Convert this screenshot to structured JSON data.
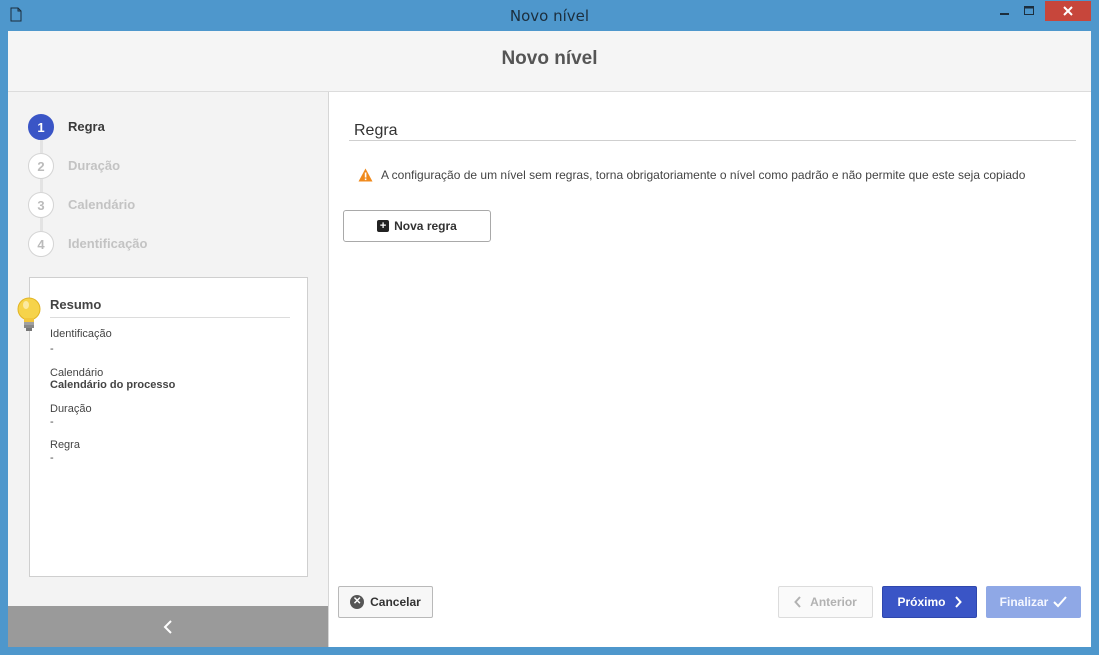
{
  "window": {
    "title": "Novo nível"
  },
  "header": {
    "title": "Novo nível"
  },
  "steps": [
    {
      "num": "1",
      "label": "Regra",
      "active": true
    },
    {
      "num": "2",
      "label": "Duração",
      "active": false
    },
    {
      "num": "3",
      "label": "Calendário",
      "active": false
    },
    {
      "num": "4",
      "label": "Identificação",
      "active": false
    }
  ],
  "summary": {
    "title": "Resumo",
    "identificacao_label": "Identificação",
    "identificacao_value": "-",
    "calendario_label": "Calendário",
    "calendario_value": "Calendário do processo",
    "duracao_label": "Duração",
    "duracao_value": "-",
    "regra_label": "Regra",
    "regra_value": "-"
  },
  "main": {
    "section_title": "Regra",
    "warning": "A configuração de um nível sem regras, torna obrigatoriamente o nível como padrão e não permite que este seja copiado",
    "new_rule_label": "Nova regra"
  },
  "footer": {
    "cancel_label": "Cancelar",
    "prev_label": "Anterior",
    "next_label": "Próximo",
    "finish_label": "Finalizar"
  },
  "colors": {
    "accent": "#3a55c6",
    "titlebar": "#4e97cc",
    "close": "#c7463b",
    "warning": "#f08a1c"
  }
}
